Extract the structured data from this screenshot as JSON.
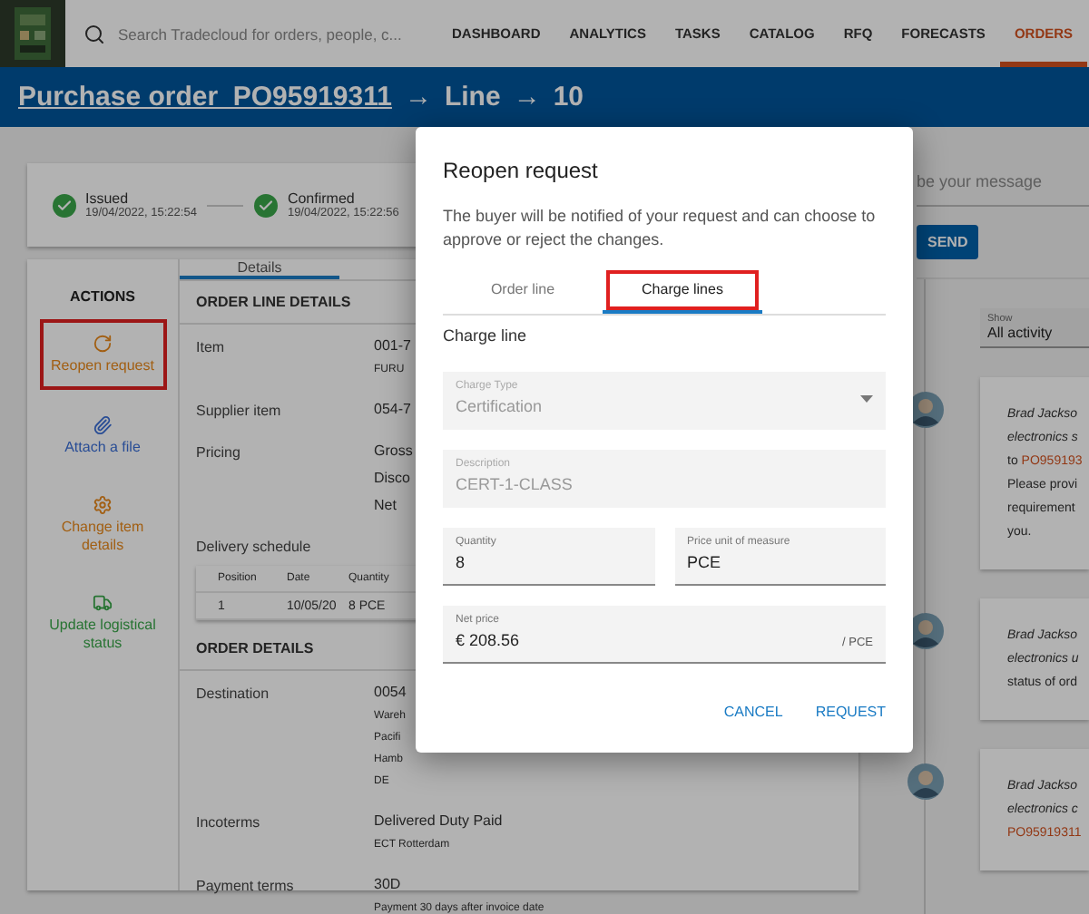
{
  "app_bar": {
    "search": {
      "placeholder": "Search Tradecloud for orders, people, c..."
    },
    "nav": [
      {
        "label": "DASHBOARD",
        "selected": false
      },
      {
        "label": "ANALYTICS",
        "selected": false
      },
      {
        "label": "TASKS",
        "selected": false
      },
      {
        "label": "CATALOG",
        "selected": false
      },
      {
        "label": "RFQ",
        "selected": false
      },
      {
        "label": "FORECASTS",
        "selected": false
      },
      {
        "label": "ORDERS",
        "selected": true
      }
    ]
  },
  "breadcrumb": {
    "order_link": "Purchase order  PO95919311",
    "parts": [
      "→",
      "Line",
      "→",
      "10"
    ]
  },
  "status_steps": [
    {
      "label": "Issued",
      "time": "19/04/2022, 15:22:54",
      "done": true
    },
    {
      "label": "Confirmed",
      "time": "19/04/2022, 15:22:56",
      "done": true
    }
  ],
  "actions": {
    "title": "ACTIONS",
    "items": [
      {
        "label": "Reopen request",
        "kind": "reopen",
        "highlighted": true
      },
      {
        "label": "Attach a file",
        "kind": "attach",
        "highlighted": false
      },
      {
        "label": "Change item details",
        "kind": "change",
        "highlighted": false
      },
      {
        "label": "Update logistical status",
        "kind": "logistics",
        "highlighted": false
      }
    ]
  },
  "details": {
    "tabs": [
      {
        "label": "Details",
        "selected": true
      }
    ],
    "sections": [
      {
        "title": "ORDER LINE DETAILS",
        "rows": [
          {
            "kind": "field",
            "label": "Item",
            "values": [
              {
                "text": "001-7",
                "kind": "main"
              },
              {
                "text": "FURU",
                "kind": "sub"
              }
            ]
          },
          {
            "kind": "field",
            "label": "Supplier item",
            "values": [
              {
                "text": "054-7",
                "kind": "main"
              }
            ]
          },
          {
            "kind": "field",
            "label": "Pricing",
            "values": [
              {
                "text": "Gross",
                "kind": "main"
              },
              {
                "text": "Disco",
                "kind": "main"
              },
              {
                "text": "Net",
                "kind": "main"
              }
            ]
          },
          {
            "kind": "schedule",
            "label": "Delivery schedule",
            "columns": [
              "Position",
              "Date",
              "Quantity"
            ],
            "rows": [
              [
                "1",
                "10/05/20",
                "8 PCE"
              ]
            ]
          }
        ]
      },
      {
        "title": "ORDER DETAILS",
        "rows": [
          {
            "kind": "field",
            "label": "Destination",
            "values": [
              {
                "text": "0054",
                "kind": "main"
              },
              {
                "text": "Wareh",
                "kind": "sub"
              },
              {
                "text": "Pacifi",
                "kind": "sub"
              },
              {
                "text": "Hamb",
                "kind": "sub"
              },
              {
                "text": "DE",
                "kind": "sub"
              }
            ]
          },
          {
            "kind": "field",
            "label": "Incoterms",
            "values": [
              {
                "text": "Delivered Duty Paid",
                "kind": "main"
              },
              {
                "text": "ECT Rotterdam",
                "kind": "sub"
              }
            ]
          },
          {
            "kind": "field",
            "label": "Payment terms",
            "values": [
              {
                "text": "30D",
                "kind": "main"
              },
              {
                "text": "Payment 30 days after invoice date",
                "kind": "sub"
              }
            ]
          }
        ]
      }
    ]
  },
  "message": {
    "placeholder": "be your message",
    "send": "SEND"
  },
  "show_filter": {
    "label": "Show",
    "value": "All activity"
  },
  "activity": [
    {
      "lines": [
        {
          "kind": "author",
          "text": "Brad Jackso"
        },
        {
          "kind": "author",
          "text": "electronics s"
        },
        {
          "kind": "link",
          "prefix": "to",
          "text": "PO959193"
        },
        {
          "kind": "plain",
          "text": "Please provi"
        },
        {
          "kind": "plain",
          "text": "requirement"
        },
        {
          "kind": "plain",
          "text": "you."
        }
      ]
    },
    {
      "lines": [
        {
          "kind": "author",
          "text": "Brad Jackso"
        },
        {
          "kind": "author",
          "text": "electronics u"
        },
        {
          "kind": "plain",
          "text": "status of ord"
        }
      ]
    },
    {
      "lines": [
        {
          "kind": "author",
          "text": "Brad Jackso"
        },
        {
          "kind": "author",
          "text": "electronics c"
        },
        {
          "kind": "link",
          "text": "PO95919311"
        }
      ]
    }
  ],
  "dialog": {
    "title": "Reopen request",
    "text": "The buyer will be notified of your request and can choose to approve or reject the changes.",
    "tabs": [
      {
        "label": "Order line",
        "selected": false,
        "highlighted": false
      },
      {
        "label": "Charge lines",
        "selected": true,
        "highlighted": true
      }
    ],
    "section": "Charge line",
    "fields": [
      [
        {
          "label": "Charge Type",
          "value": "Certification",
          "kind": "select",
          "disabled": true
        }
      ],
      [
        {
          "label": "Description",
          "value": "CERT-1-CLASS",
          "kind": "text",
          "disabled": true
        }
      ],
      [
        {
          "label": "Quantity",
          "value": "8",
          "kind": "text",
          "disabled": false
        },
        {
          "label": "Price unit of measure",
          "value": "PCE",
          "kind": "text",
          "disabled": false
        }
      ],
      [
        {
          "label": "Net price",
          "value": "€ 208.56",
          "suffix": "/ PCE",
          "kind": "text",
          "disabled": false
        }
      ]
    ],
    "buttons": [
      "CANCEL",
      "REQUEST"
    ]
  }
}
